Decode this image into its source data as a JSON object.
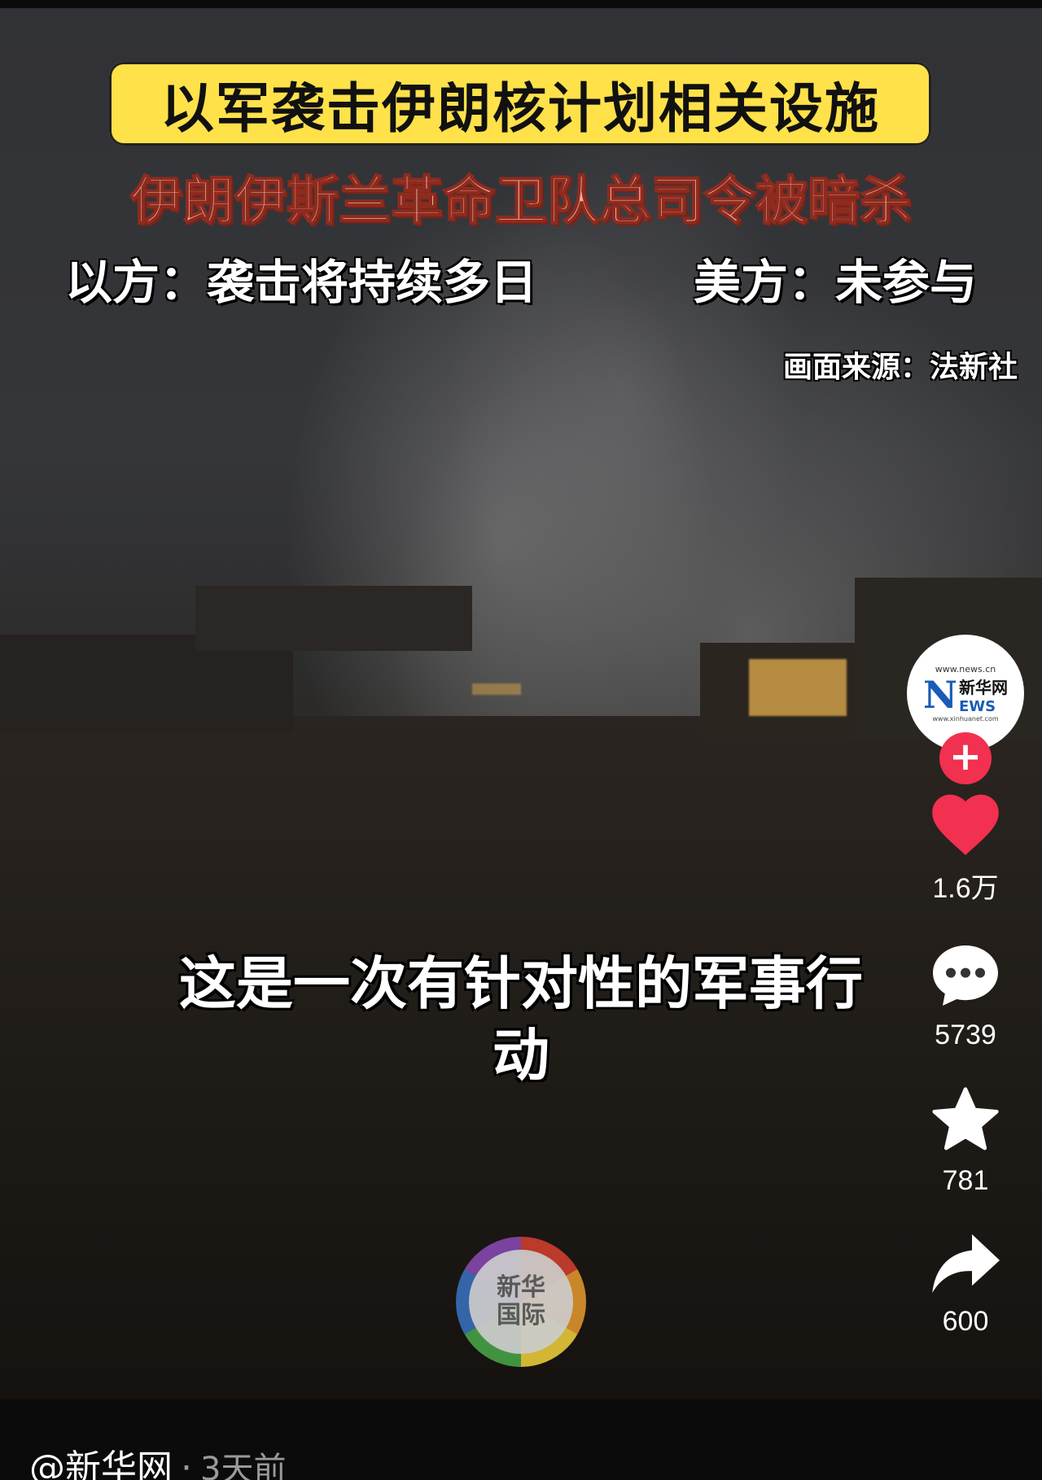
{
  "overlay": {
    "headline": "以军袭击伊朗核计划相关设施",
    "subhead": "伊朗伊斯兰革命卫队总司令被暗杀",
    "line_left": "以方：袭击将持续多日",
    "line_right": "美方：未参与",
    "source": "画面来源：法新社",
    "subtitle_line1": "这是一次有针对性的军事行",
    "subtitle_line2": "动",
    "watermark_line1": "新华",
    "watermark_line2": "国际"
  },
  "account": {
    "avatar_top": "www.news.cn",
    "avatar_letter": "N",
    "avatar_name": "新华网",
    "avatar_sub": "EWS",
    "avatar_bottom": "www.xinhuanet.com",
    "follow_symbol": "+"
  },
  "actions": {
    "likes": "1.6万",
    "comments": "5739",
    "favorites": "781",
    "shares": "600",
    "like_color": "#f2304f"
  },
  "footer": {
    "author": "@新华网",
    "separator": "·",
    "time": "3天前"
  }
}
